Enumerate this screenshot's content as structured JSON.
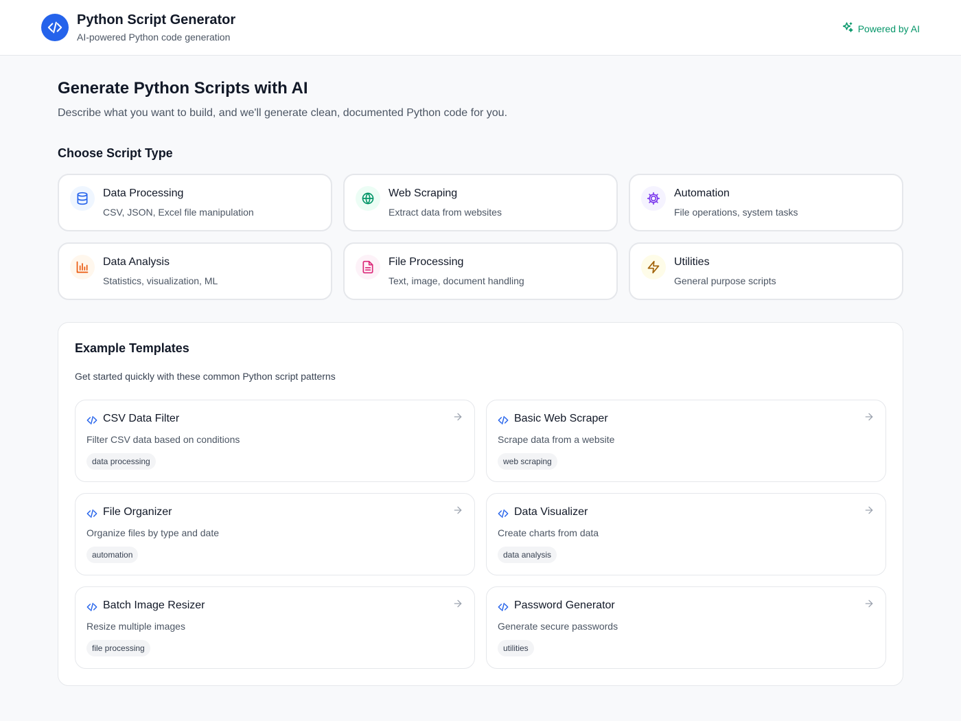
{
  "header": {
    "title": "Python Script Generator",
    "subtitle": "AI-powered Python code generation",
    "powered_by": "Powered by AI"
  },
  "main": {
    "title": "Generate Python Scripts with AI",
    "description": "Describe what you want to build, and we'll generate clean, documented Python code for you.",
    "script_type_heading": "Choose Script Type"
  },
  "script_types": [
    {
      "name": "Data Processing",
      "description": "CSV, JSON, Excel file manipulation",
      "icon": "database-icon",
      "color": "#2563eb",
      "bg": "#eff6ff"
    },
    {
      "name": "Web Scraping",
      "description": "Extract data from websites",
      "icon": "globe-icon",
      "color": "#059669",
      "bg": "#ecfdf5"
    },
    {
      "name": "Automation",
      "description": "File operations, system tasks",
      "icon": "cog-icon",
      "color": "#7c3aed",
      "bg": "#f5f3ff"
    },
    {
      "name": "Data Analysis",
      "description": "Statistics, visualization, ML",
      "icon": "bar-chart-icon",
      "color": "#ea580c",
      "bg": "#fff7ed"
    },
    {
      "name": "File Processing",
      "description": "Text, image, document handling",
      "icon": "file-text-icon",
      "color": "#db2777",
      "bg": "#fdf2f8"
    },
    {
      "name": "Utilities",
      "description": "General purpose scripts",
      "icon": "zap-icon",
      "color": "#a16207",
      "bg": "#fefce8"
    }
  ],
  "templates": {
    "title": "Example Templates",
    "description": "Get started quickly with these common Python script patterns",
    "items": [
      {
        "name": "CSV Data Filter",
        "description": "Filter CSV data based on conditions",
        "tag": "data processing"
      },
      {
        "name": "Basic Web Scraper",
        "description": "Scrape data from a website",
        "tag": "web scraping"
      },
      {
        "name": "File Organizer",
        "description": "Organize files by type and date",
        "tag": "automation"
      },
      {
        "name": "Data Visualizer",
        "description": "Create charts from data",
        "tag": "data analysis"
      },
      {
        "name": "Batch Image Resizer",
        "description": "Resize multiple images",
        "tag": "file processing"
      },
      {
        "name": "Password Generator",
        "description": "Generate secure passwords",
        "tag": "utilities"
      }
    ]
  },
  "colors": {
    "accent": "#2563eb",
    "powered": "#059669"
  }
}
